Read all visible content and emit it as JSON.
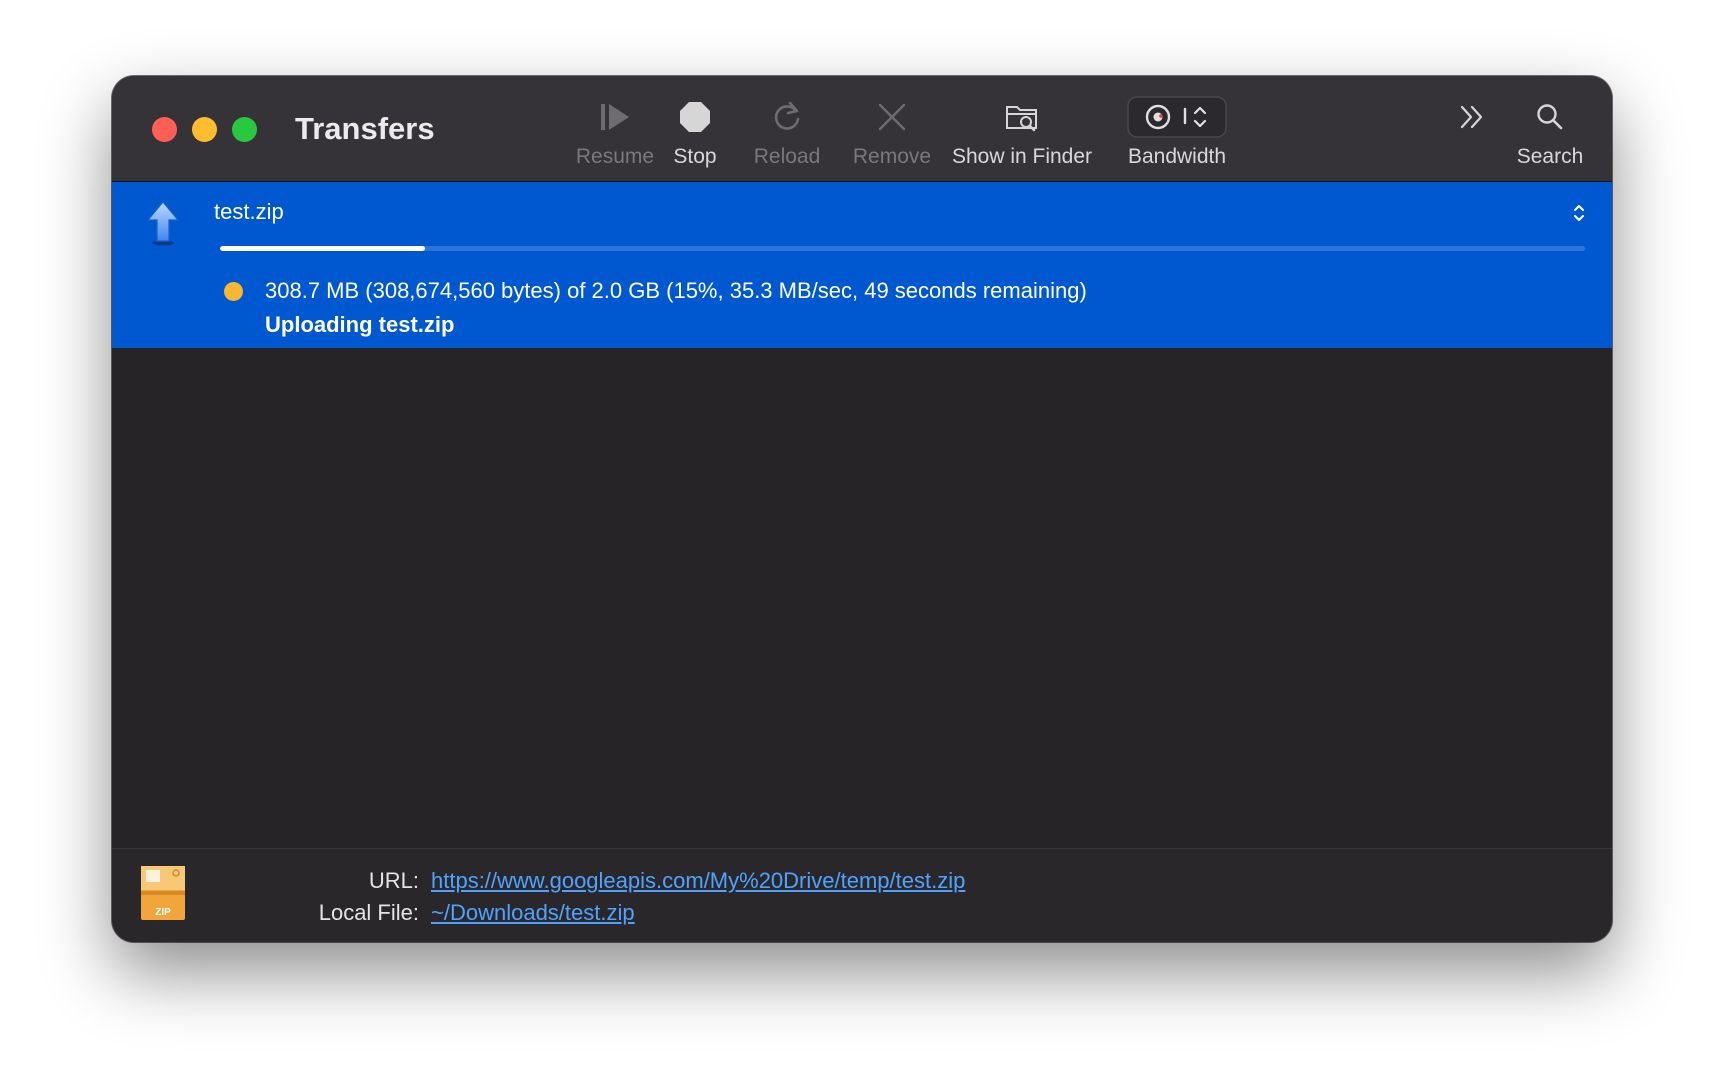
{
  "window": {
    "title": "Transfers"
  },
  "toolbar": {
    "resume": {
      "label": "Resume",
      "icon": "play-icon",
      "enabled": false
    },
    "stop": {
      "label": "Stop",
      "icon": "stop-icon",
      "enabled": true
    },
    "reload": {
      "label": "Reload",
      "icon": "reload-icon",
      "enabled": false
    },
    "remove": {
      "label": "Remove",
      "icon": "close-icon",
      "enabled": false
    },
    "show_in_finder": {
      "label": "Show in Finder",
      "icon": "folder-search-icon",
      "enabled": true
    },
    "bandwidth": {
      "label": "Bandwidth",
      "icon": "bandwidth-gauge-icon",
      "enabled": true
    },
    "overflow": {
      "icon": "double-chevron-right-icon"
    },
    "search": {
      "label": "Search",
      "icon": "search-icon",
      "enabled": true
    }
  },
  "transfer": {
    "filename": "test.zip",
    "direction_icon": "upload-arrow-icon",
    "progress_fraction": 0.15,
    "status_dot_color": "#f7b731",
    "status_line": "308.7 MB (308,674,560 bytes) of 2.0 GB (15%, 35.3 MB/sec, 49 seconds remaining)",
    "status_sub": "Uploading test.zip"
  },
  "details": {
    "file_icon": "zip-archive-icon",
    "url_label": "URL:",
    "url": "https://www.googleapis.com/My%20Drive/temp/test.zip",
    "local_file_label": "Local File:",
    "local_file": "~/Downloads/test.zip"
  },
  "colors": {
    "selection": "#0058d0",
    "window_background": "#272428",
    "link": "#4fa3ff"
  }
}
